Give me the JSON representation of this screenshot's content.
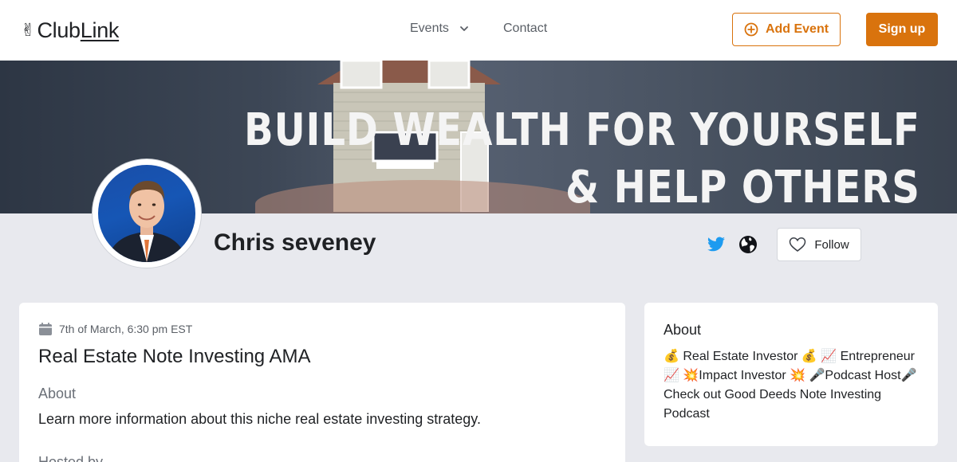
{
  "header": {
    "logo_hand": "✌",
    "logo_club": "Club",
    "logo_link": "Link",
    "nav": {
      "events_label": "Events",
      "contact_label": "Contact"
    },
    "add_event_label": "Add Event",
    "signup_label": "Sign up"
  },
  "banner": {
    "line1": "Build wealth for yourself",
    "line2": "& help others"
  },
  "profile": {
    "name": "Chris seveney",
    "follow_label": "Follow",
    "icons": [
      "twitter-icon",
      "globe-icon",
      "heart-icon"
    ]
  },
  "event": {
    "date": "7th of March, 6:30 pm EST",
    "title": "Real Estate Note Investing AMA",
    "about_label": "About",
    "about_text": "Learn more information about this niche real estate investing strategy.",
    "hosted_label": "Hosted by"
  },
  "about_card": {
    "title": "About",
    "text": "💰 Real Estate Investor 💰 📈 Entrepreneur 📈 💥Impact Investor 💥 🎤Podcast Host🎤 Check out Good Deeds Note Investing Podcast"
  },
  "colors": {
    "accent": "#d9730d",
    "twitter": "#1d9bf0",
    "page_bg": "#e8e9ee",
    "card_bg": "#ffffff"
  }
}
